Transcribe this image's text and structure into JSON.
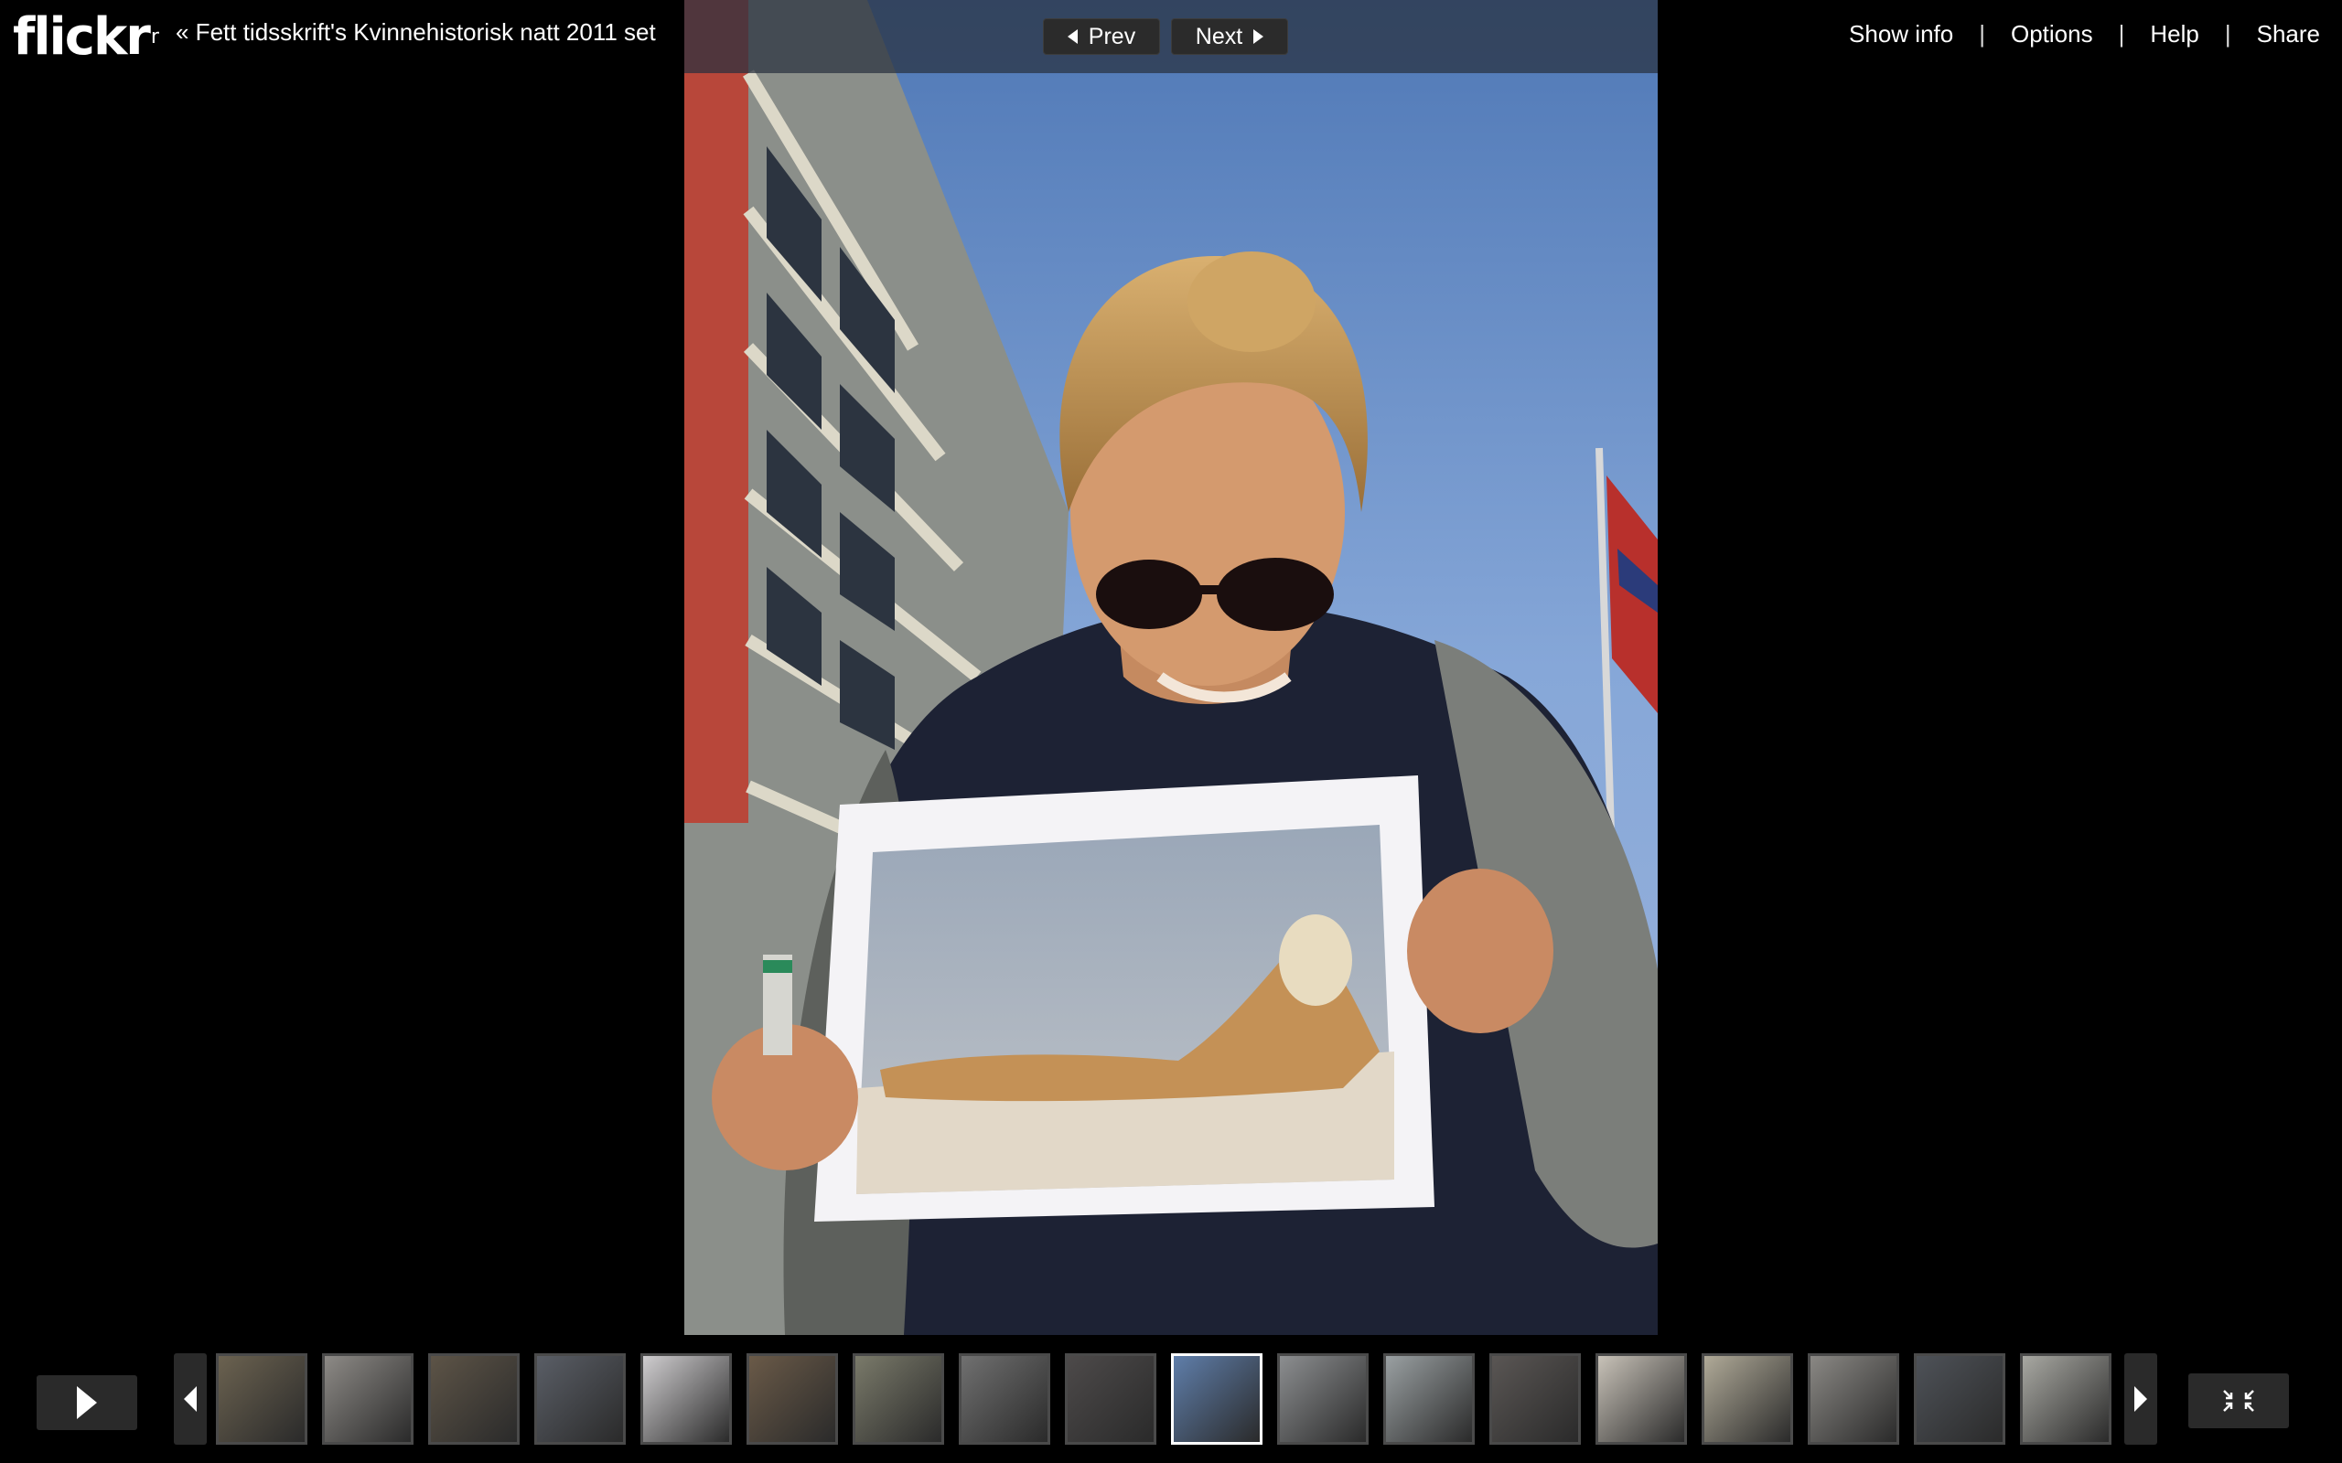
{
  "header": {
    "logo": "flickr",
    "set_link": "« Fett tidsskrift's Kvinnehistorisk natt 2011 set",
    "prev_label": "Prev",
    "next_label": "Next"
  },
  "menu": {
    "show_info": "Show info",
    "options": "Options",
    "help": "Help",
    "share": "Share",
    "separator": "|"
  },
  "photo": {
    "subject": "woman in sunglasses holding a printed photo of a mermaid on a beach"
  },
  "filmstrip": {
    "thumbnails": [
      {
        "tone": "#6b6250"
      },
      {
        "tone": "#8d8a86"
      },
      {
        "tone": "#5d5447"
      },
      {
        "tone": "#5a5e66"
      },
      {
        "tone": "#cfcdcf"
      },
      {
        "tone": "#6a5a48"
      },
      {
        "tone": "#7a7a6a"
      },
      {
        "tone": "#707070"
      },
      {
        "tone": "#4d4a4a"
      },
      {
        "tone": "#5f7eaa"
      },
      {
        "tone": "#8c8e90"
      },
      {
        "tone": "#9aa0a2"
      },
      {
        "tone": "#5a5654"
      },
      {
        "tone": "#c8c2b8"
      },
      {
        "tone": "#b0aa98"
      },
      {
        "tone": "#8a8884"
      },
      {
        "tone": "#4e5258"
      },
      {
        "tone": "#a8a8a2"
      }
    ],
    "active_index": 9
  }
}
